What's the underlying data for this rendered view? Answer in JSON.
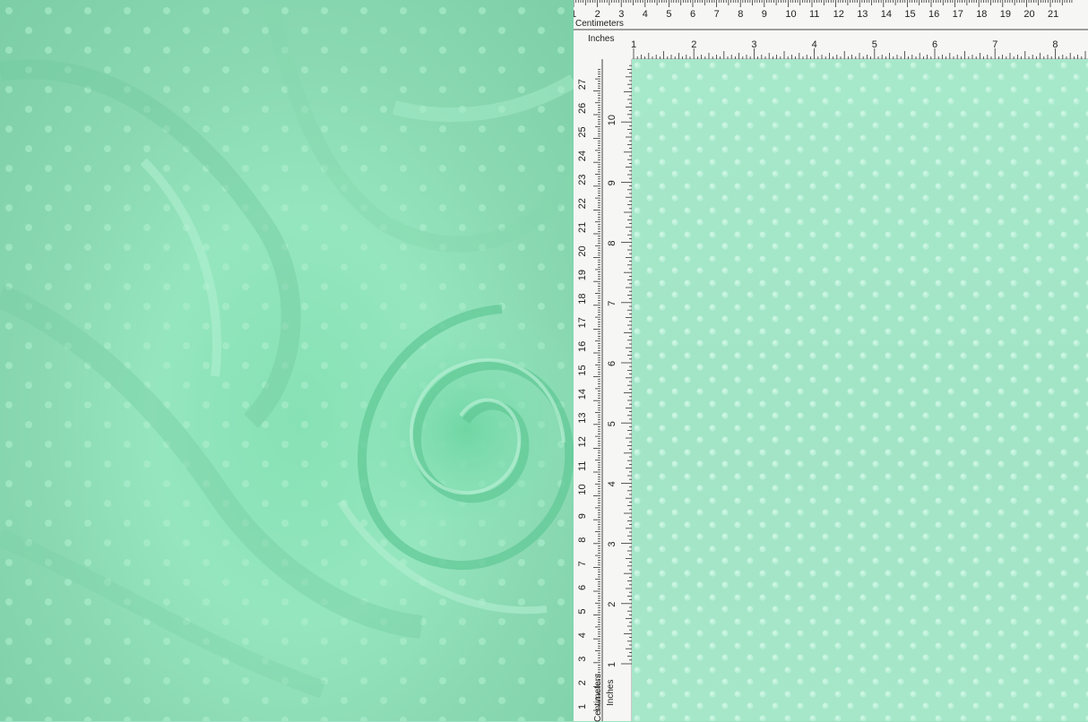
{
  "photo": {
    "subject": "",
    "fabric_color": "#9fe3c3"
  },
  "ruler_top": {
    "cm_label": "Centimeters",
    "inch_label": "Inches",
    "cm_range": [
      1,
      21
    ],
    "inch_range": [
      1,
      8
    ]
  },
  "ruler_left": {
    "cm_label": "Centimeters",
    "inch_label": "Inches",
    "cm_range": [
      1,
      27
    ],
    "inch_range": [
      1,
      10
    ]
  }
}
